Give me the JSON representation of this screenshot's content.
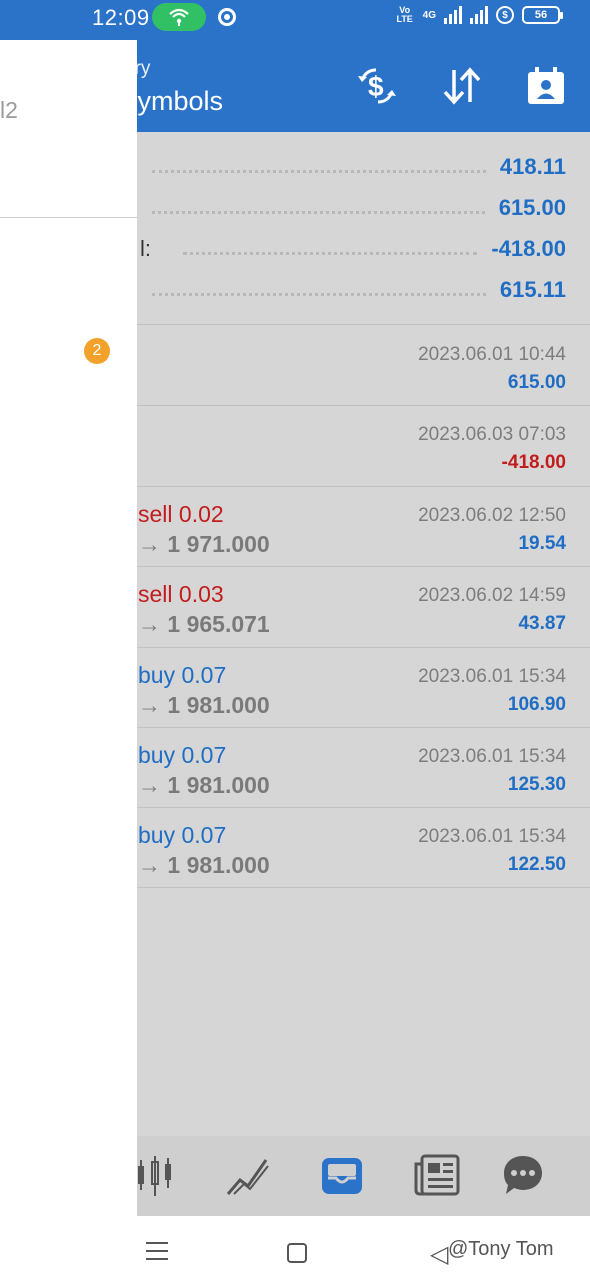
{
  "status_bar": {
    "time": "12:09",
    "network": "4G",
    "volte": "Vo LTE",
    "battery": "56"
  },
  "header": {
    "title_partial": "ory",
    "subtitle_partial": "symbols",
    "icons": [
      "currency-exchange-icon",
      "sort-icon",
      "calendar-contact-icon"
    ]
  },
  "summary": {
    "rows": [
      {
        "label": "",
        "value": "418.11"
      },
      {
        "label": "",
        "value": "615.00"
      },
      {
        "label": "l:",
        "value": "-418.00"
      },
      {
        "label": "",
        "value": "615.11"
      }
    ]
  },
  "deals": [
    {
      "title": "",
      "price": "",
      "date": "2023.06.01 10:44",
      "amount": "615.00",
      "sign": "pos"
    },
    {
      "title": "",
      "price": "",
      "date": "2023.06.03 07:03",
      "amount": "-418.00",
      "sign": "neg"
    },
    {
      "title": "sell 0.02",
      "side": "sell",
      "price": "→ 1 971.000",
      "date": "2023.06.02 12:50",
      "amount": "19.54",
      "sign": "pos"
    },
    {
      "title": "sell 0.03",
      "side": "sell",
      "price": "→ 1 965.071",
      "date": "2023.06.02 14:59",
      "amount": "43.87",
      "sign": "pos"
    },
    {
      "title": "buy 0.07",
      "side": "buy",
      "price": "→ 1 981.000",
      "date": "2023.06.01 15:34",
      "amount": "106.90",
      "sign": "pos"
    },
    {
      "title": "buy 0.07",
      "side": "buy",
      "price": "→ 1 981.000",
      "date": "2023.06.01 15:34",
      "amount": "125.30",
      "sign": "pos"
    },
    {
      "title": "buy 0.07",
      "side": "buy",
      "price": "→ 1 981.000",
      "date": "2023.06.01 15:34",
      "amount": "122.50",
      "sign": "pos"
    }
  ],
  "drawer": {
    "cut_text": "l2",
    "badge_count": "2"
  },
  "tabs": [
    {
      "icon": "quotes-icon"
    },
    {
      "icon": "chart-icon"
    },
    {
      "icon": "trade-inbox-icon",
      "active": true
    },
    {
      "icon": "news-icon"
    },
    {
      "icon": "chat-icon"
    }
  ],
  "watermark": "@Tony Tom",
  "colors": {
    "primary": "#2a73c8",
    "sell": "#c31c1c",
    "buy": "#1f6dc4",
    "badge": "#f2a12a"
  }
}
